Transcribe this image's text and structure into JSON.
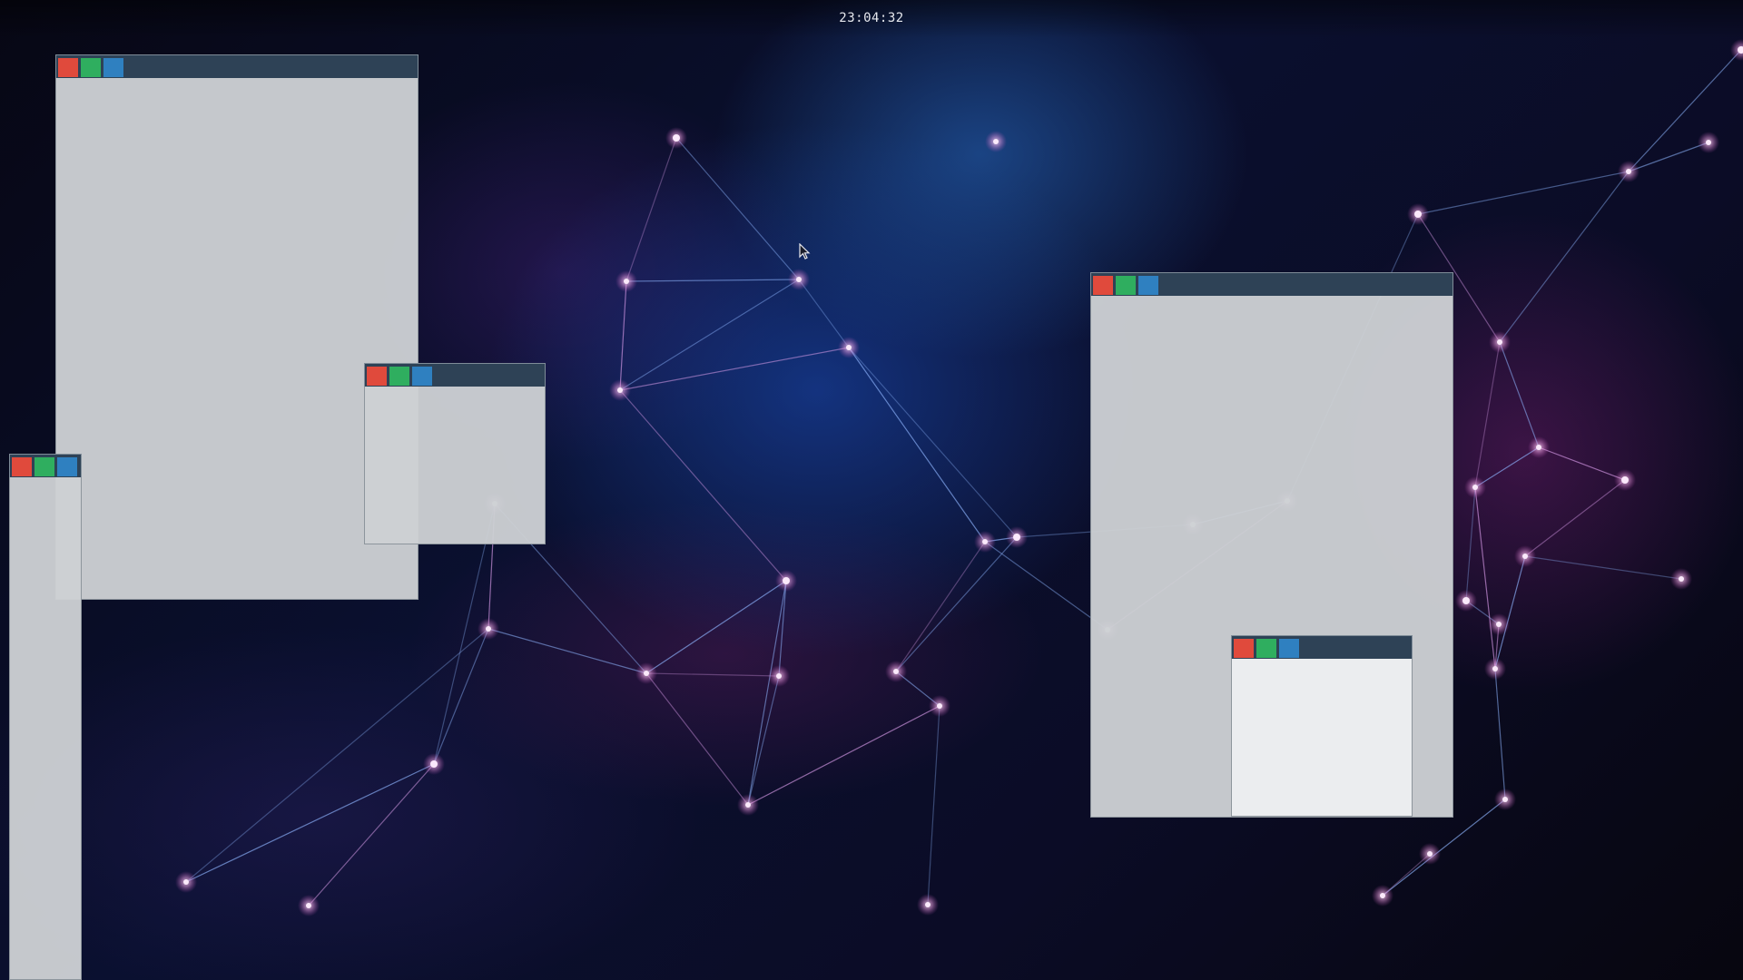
{
  "topbar": {
    "clock": "23:04:32"
  },
  "desktop": {
    "wallpaper": "network-constellation",
    "colors": {
      "titlebar": "#2e4256",
      "close_button": "#e04a3c",
      "maximize_button": "#2fae5f",
      "minimize_button": "#2f80c0",
      "window_body": "#cdd0d3",
      "window_body_light": "#eceef0"
    }
  },
  "windows": [
    {
      "id": "window-1",
      "buttons": [
        "close-icon",
        "maximize-icon",
        "minimize-icon"
      ]
    },
    {
      "id": "window-2",
      "buttons": [
        "close-icon",
        "maximize-icon",
        "minimize-icon"
      ]
    },
    {
      "id": "window-3",
      "buttons": [
        "close-icon",
        "maximize-icon",
        "minimize-icon"
      ]
    },
    {
      "id": "window-4",
      "buttons": [
        "close-icon",
        "maximize-icon",
        "minimize-icon"
      ]
    },
    {
      "id": "window-5",
      "buttons": [
        "close-icon",
        "maximize-icon",
        "minimize-icon"
      ]
    }
  ],
  "cursor": {
    "icon": "arrow-cursor-icon"
  }
}
